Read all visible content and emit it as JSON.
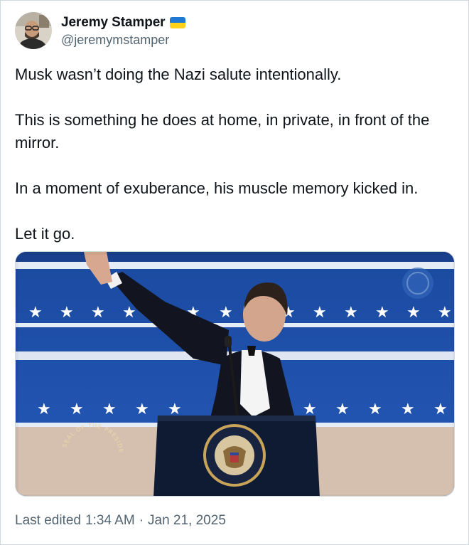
{
  "author": {
    "display_name": "Jeremy Stamper",
    "handle": "@jeremymstamper",
    "flag_icon": "ukraine-flag-icon",
    "flag_colors": [
      "#1f78d1",
      "#ffd21a"
    ]
  },
  "tweet": {
    "paragraphs": [
      "Musk wasn’t doing the Nazi salute intentionally.",
      "This is something he does at home, in private, in front of the mirror.",
      "In a moment of exuberance, his muscle memory kicked in.",
      "Let it go."
    ],
    "media_seal_text": "SEAL OF THE PRESIDENT OF THE UNITED STATES"
  },
  "footer": {
    "edited_label": "Last edited",
    "time": "1:34 AM",
    "separator": "·",
    "date": "Jan 21, 2025"
  },
  "colors": {
    "text_primary": "#0f1419",
    "text_secondary": "#536471",
    "border": "#cfd9de",
    "backdrop_blue": "#1d4fa6"
  }
}
